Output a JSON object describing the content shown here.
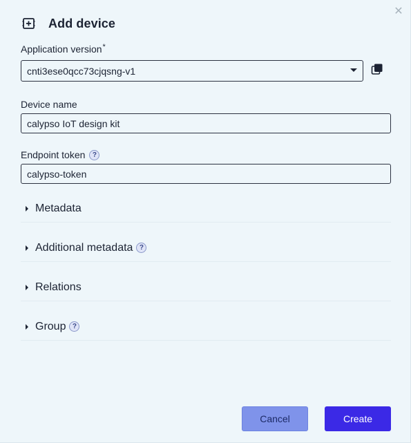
{
  "dialog": {
    "title": "Add device",
    "close_icon": "close-icon",
    "header_icon": "add-device-icon"
  },
  "fields": {
    "app_version": {
      "label": "Application version",
      "required_mark": "*",
      "value": "cnti3ese0qcc73cjqsng-v1"
    },
    "device_name": {
      "label": "Device name",
      "value": "calypso IoT design kit"
    },
    "endpoint_token": {
      "label": "Endpoint token",
      "help": "?",
      "value": "calypso-token"
    }
  },
  "sections": [
    {
      "label": "Metadata",
      "help": ""
    },
    {
      "label": "Additional metadata",
      "help": "?"
    },
    {
      "label": "Relations",
      "help": ""
    },
    {
      "label": "Group",
      "help": "?"
    }
  ],
  "buttons": {
    "cancel": "Cancel",
    "create": "Create"
  },
  "colors": {
    "accent": "#3b29e6",
    "cancel_bg": "#7f93ea",
    "background": "#eef6fa"
  }
}
